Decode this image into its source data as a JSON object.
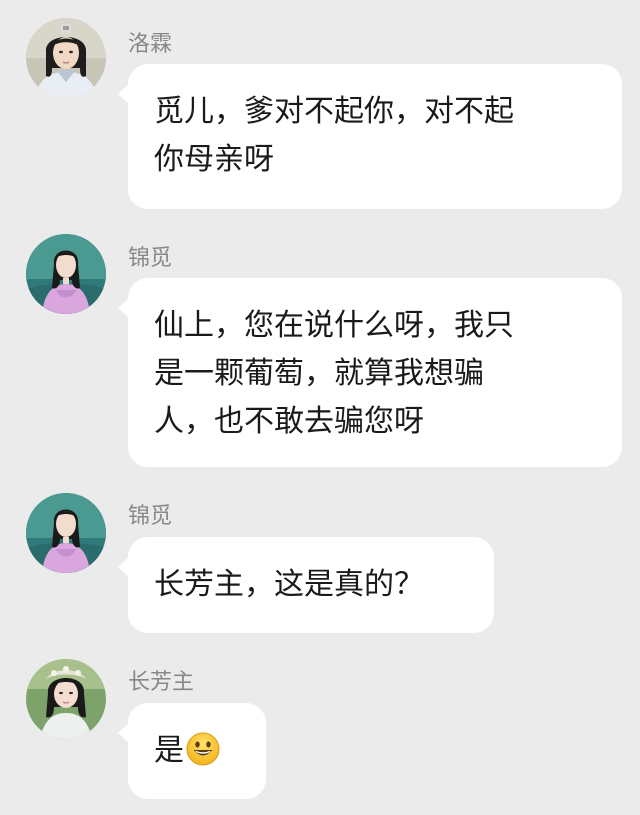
{
  "messages": [
    {
      "sender": "洛霖",
      "avatar_icon": "man-long-hair-avatar",
      "text": "觅儿，爹对不起你，对不起\n你母亲呀"
    },
    {
      "sender": "锦觅",
      "avatar_icon": "woman-pink-robe-avatar",
      "text": "仙上，您在说什么呀，我只\n是一颗葡萄，就算我想骗\n人，也不敢去骗您呀"
    },
    {
      "sender": "锦觅",
      "avatar_icon": "woman-pink-robe-avatar",
      "text": "长芳主，这是真的？"
    },
    {
      "sender": "长芳主",
      "avatar_icon": "woman-headdress-avatar",
      "text": "是",
      "emoji": "grinning-face-icon"
    }
  ],
  "colors": {
    "background": "#ebebeb",
    "bubble": "#ffffff",
    "name_text": "#888888",
    "message_text": "#1a1a1a",
    "emoji_yellow": "#f7c531"
  }
}
